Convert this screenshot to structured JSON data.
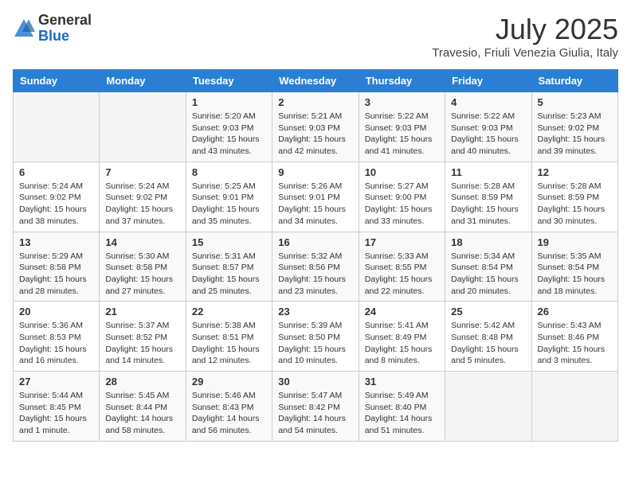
{
  "logo": {
    "general": "General",
    "blue": "Blue"
  },
  "title": {
    "month": "July 2025",
    "location": "Travesio, Friuli Venezia Giulia, Italy"
  },
  "headers": [
    "Sunday",
    "Monday",
    "Tuesday",
    "Wednesday",
    "Thursday",
    "Friday",
    "Saturday"
  ],
  "weeks": [
    [
      {
        "day": "",
        "sunrise": "",
        "sunset": "",
        "daylight": ""
      },
      {
        "day": "",
        "sunrise": "",
        "sunset": "",
        "daylight": ""
      },
      {
        "day": "1",
        "sunrise": "Sunrise: 5:20 AM",
        "sunset": "Sunset: 9:03 PM",
        "daylight": "Daylight: 15 hours and 43 minutes."
      },
      {
        "day": "2",
        "sunrise": "Sunrise: 5:21 AM",
        "sunset": "Sunset: 9:03 PM",
        "daylight": "Daylight: 15 hours and 42 minutes."
      },
      {
        "day": "3",
        "sunrise": "Sunrise: 5:22 AM",
        "sunset": "Sunset: 9:03 PM",
        "daylight": "Daylight: 15 hours and 41 minutes."
      },
      {
        "day": "4",
        "sunrise": "Sunrise: 5:22 AM",
        "sunset": "Sunset: 9:03 PM",
        "daylight": "Daylight: 15 hours and 40 minutes."
      },
      {
        "day": "5",
        "sunrise": "Sunrise: 5:23 AM",
        "sunset": "Sunset: 9:02 PM",
        "daylight": "Daylight: 15 hours and 39 minutes."
      }
    ],
    [
      {
        "day": "6",
        "sunrise": "Sunrise: 5:24 AM",
        "sunset": "Sunset: 9:02 PM",
        "daylight": "Daylight: 15 hours and 38 minutes."
      },
      {
        "day": "7",
        "sunrise": "Sunrise: 5:24 AM",
        "sunset": "Sunset: 9:02 PM",
        "daylight": "Daylight: 15 hours and 37 minutes."
      },
      {
        "day": "8",
        "sunrise": "Sunrise: 5:25 AM",
        "sunset": "Sunset: 9:01 PM",
        "daylight": "Daylight: 15 hours and 35 minutes."
      },
      {
        "day": "9",
        "sunrise": "Sunrise: 5:26 AM",
        "sunset": "Sunset: 9:01 PM",
        "daylight": "Daylight: 15 hours and 34 minutes."
      },
      {
        "day": "10",
        "sunrise": "Sunrise: 5:27 AM",
        "sunset": "Sunset: 9:00 PM",
        "daylight": "Daylight: 15 hours and 33 minutes."
      },
      {
        "day": "11",
        "sunrise": "Sunrise: 5:28 AM",
        "sunset": "Sunset: 8:59 PM",
        "daylight": "Daylight: 15 hours and 31 minutes."
      },
      {
        "day": "12",
        "sunrise": "Sunrise: 5:28 AM",
        "sunset": "Sunset: 8:59 PM",
        "daylight": "Daylight: 15 hours and 30 minutes."
      }
    ],
    [
      {
        "day": "13",
        "sunrise": "Sunrise: 5:29 AM",
        "sunset": "Sunset: 8:58 PM",
        "daylight": "Daylight: 15 hours and 28 minutes."
      },
      {
        "day": "14",
        "sunrise": "Sunrise: 5:30 AM",
        "sunset": "Sunset: 8:58 PM",
        "daylight": "Daylight: 15 hours and 27 minutes."
      },
      {
        "day": "15",
        "sunrise": "Sunrise: 5:31 AM",
        "sunset": "Sunset: 8:57 PM",
        "daylight": "Daylight: 15 hours and 25 minutes."
      },
      {
        "day": "16",
        "sunrise": "Sunrise: 5:32 AM",
        "sunset": "Sunset: 8:56 PM",
        "daylight": "Daylight: 15 hours and 23 minutes."
      },
      {
        "day": "17",
        "sunrise": "Sunrise: 5:33 AM",
        "sunset": "Sunset: 8:55 PM",
        "daylight": "Daylight: 15 hours and 22 minutes."
      },
      {
        "day": "18",
        "sunrise": "Sunrise: 5:34 AM",
        "sunset": "Sunset: 8:54 PM",
        "daylight": "Daylight: 15 hours and 20 minutes."
      },
      {
        "day": "19",
        "sunrise": "Sunrise: 5:35 AM",
        "sunset": "Sunset: 8:54 PM",
        "daylight": "Daylight: 15 hours and 18 minutes."
      }
    ],
    [
      {
        "day": "20",
        "sunrise": "Sunrise: 5:36 AM",
        "sunset": "Sunset: 8:53 PM",
        "daylight": "Daylight: 15 hours and 16 minutes."
      },
      {
        "day": "21",
        "sunrise": "Sunrise: 5:37 AM",
        "sunset": "Sunset: 8:52 PM",
        "daylight": "Daylight: 15 hours and 14 minutes."
      },
      {
        "day": "22",
        "sunrise": "Sunrise: 5:38 AM",
        "sunset": "Sunset: 8:51 PM",
        "daylight": "Daylight: 15 hours and 12 minutes."
      },
      {
        "day": "23",
        "sunrise": "Sunrise: 5:39 AM",
        "sunset": "Sunset: 8:50 PM",
        "daylight": "Daylight: 15 hours and 10 minutes."
      },
      {
        "day": "24",
        "sunrise": "Sunrise: 5:41 AM",
        "sunset": "Sunset: 8:49 PM",
        "daylight": "Daylight: 15 hours and 8 minutes."
      },
      {
        "day": "25",
        "sunrise": "Sunrise: 5:42 AM",
        "sunset": "Sunset: 8:48 PM",
        "daylight": "Daylight: 15 hours and 5 minutes."
      },
      {
        "day": "26",
        "sunrise": "Sunrise: 5:43 AM",
        "sunset": "Sunset: 8:46 PM",
        "daylight": "Daylight: 15 hours and 3 minutes."
      }
    ],
    [
      {
        "day": "27",
        "sunrise": "Sunrise: 5:44 AM",
        "sunset": "Sunset: 8:45 PM",
        "daylight": "Daylight: 15 hours and 1 minute."
      },
      {
        "day": "28",
        "sunrise": "Sunrise: 5:45 AM",
        "sunset": "Sunset: 8:44 PM",
        "daylight": "Daylight: 14 hours and 58 minutes."
      },
      {
        "day": "29",
        "sunrise": "Sunrise: 5:46 AM",
        "sunset": "Sunset: 8:43 PM",
        "daylight": "Daylight: 14 hours and 56 minutes."
      },
      {
        "day": "30",
        "sunrise": "Sunrise: 5:47 AM",
        "sunset": "Sunset: 8:42 PM",
        "daylight": "Daylight: 14 hours and 54 minutes."
      },
      {
        "day": "31",
        "sunrise": "Sunrise: 5:49 AM",
        "sunset": "Sunset: 8:40 PM",
        "daylight": "Daylight: 14 hours and 51 minutes."
      },
      {
        "day": "",
        "sunrise": "",
        "sunset": "",
        "daylight": ""
      },
      {
        "day": "",
        "sunrise": "",
        "sunset": "",
        "daylight": ""
      }
    ]
  ]
}
